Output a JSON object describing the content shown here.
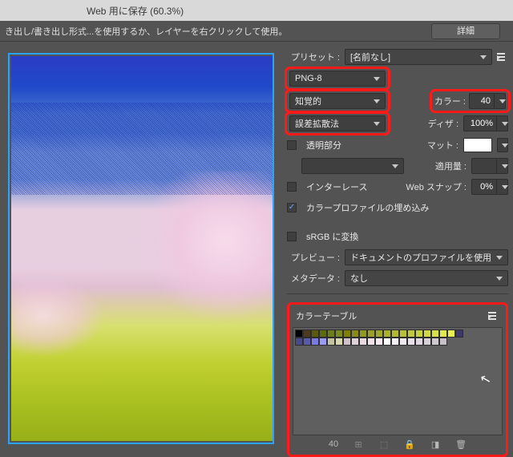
{
  "title": "Web 用に保存 (60.3%)",
  "infobar_text": "き出し/書き出し形式...を使用するか、レイヤーを右クリックして使用。",
  "detail_button": "詳細",
  "labels": {
    "preset": "プリセット :",
    "colors": "カラー :",
    "dither": "ディザ :",
    "transparency": "透明部分",
    "matte": "マット :",
    "apply_amount": "適用量 :",
    "interlace": "インターレース",
    "web_snap": "Web スナップ :",
    "embed_profile": "カラープロファイルの埋め込み",
    "convert_srgb": "sRGB に変換",
    "preview": "プレビュー :",
    "metadata": "メタデータ :",
    "color_table": "カラーテーブル"
  },
  "values": {
    "preset": "[名前なし]",
    "format": "PNG-8",
    "reduction": "知覚的",
    "colors": "40",
    "dither_method": "誤差拡散法",
    "dither": "100%",
    "apply_amount": "",
    "web_snap": "0%",
    "preview": "ドキュメントのプロファイルを使用",
    "metadata": "なし",
    "ct_count": "40"
  },
  "checks": {
    "transparency": false,
    "interlace": false,
    "embed_profile": true,
    "convert_srgb": false
  },
  "color_table": [
    "#000000",
    "#4b3b1a",
    "#5a5a0f",
    "#5c6a14",
    "#6e7d1c",
    "#7a8a20",
    "#808000",
    "#8a8a1a",
    "#8f9a24",
    "#9aa028",
    "#a0a82c",
    "#a8b030",
    "#b0b834",
    "#b8c038",
    "#c0c83c",
    "#c8d040",
    "#d0d844",
    "#d8e048",
    "#e0e84c",
    "#e8f050",
    "#3a3a6a",
    "#4a4a8a",
    "#5a5aaa",
    "#7a7ae0",
    "#9a9af8",
    "#c3c3a0",
    "#d8d8b0",
    "#d0c0c8",
    "#e0d0d8",
    "#e8d8e0",
    "#f0e0e8",
    "#f8e8f0",
    "#ffffff",
    "#f8f0f8",
    "#f0e8f0",
    "#e8e0e8",
    "#e0d8e0",
    "#d8d0d8",
    "#d0c8d0",
    "#c8c0c8"
  ]
}
